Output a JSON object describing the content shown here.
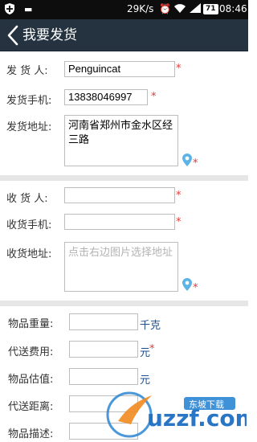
{
  "status_bar": {
    "speed": "29K/s",
    "battery": "71",
    "time": "08:46"
  },
  "header": {
    "title": "我要发货"
  },
  "sender": {
    "name_label": "发 货 人:",
    "name_value": "Penguincat",
    "phone_label": "发货手机:",
    "phone_value": "13838046997",
    "address_label": "发货地址:",
    "address_value": "河南省郑州市金水区经三路"
  },
  "receiver": {
    "name_label": "收 货 人:",
    "name_value": "",
    "phone_label": "收货手机:",
    "phone_value": "",
    "address_label": "收货地址:",
    "address_placeholder": "点击右边图片选择地址"
  },
  "goods": {
    "weight_label": "物品重量:",
    "weight_unit": "千克",
    "fee_label": "代送费用:",
    "fee_unit": "元",
    "value_label": "物品估值:",
    "value_unit": "元",
    "distance_label": "代送距离:",
    "desc_label": "物品描述:"
  },
  "required_mark": "*",
  "watermark": {
    "text": "uzzf.com",
    "badge": "东坡下载"
  },
  "colors": {
    "title_bar": "#253240",
    "required": "#e53935",
    "unit": "#1f4e8c",
    "pin": "#5bb4e5"
  }
}
